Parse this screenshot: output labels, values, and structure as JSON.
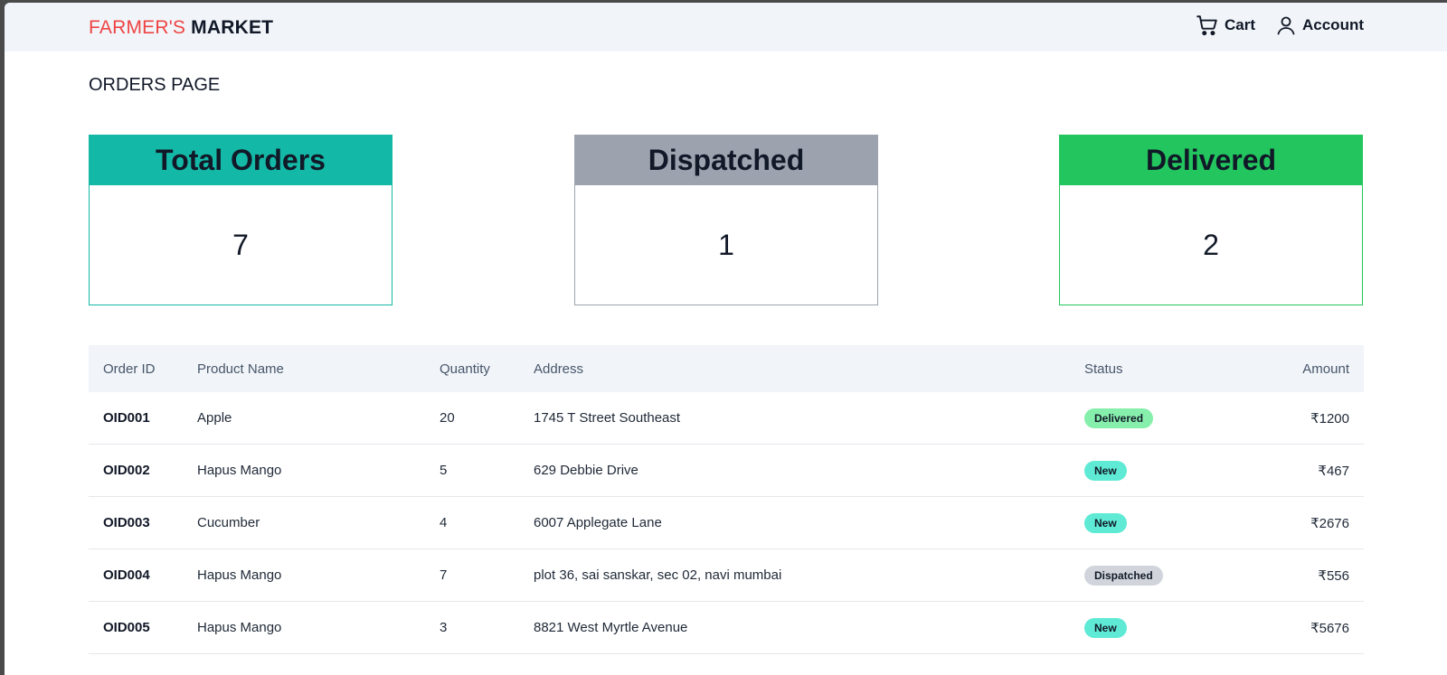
{
  "brand": {
    "part1": "FARMER'S",
    "part2": "MARKET"
  },
  "nav": {
    "cart_label": "Cart",
    "cart_icon": "cart-icon",
    "account_label": "Account",
    "account_icon": "user-icon"
  },
  "page_title": "ORDERS PAGE",
  "stats": [
    {
      "label": "Total Orders",
      "value": "7",
      "color": "#14b8a6"
    },
    {
      "label": "Dispatched",
      "value": "1",
      "color": "#9ca3af"
    },
    {
      "label": "Delivered",
      "value": "2",
      "color": "#22c55e"
    }
  ],
  "table": {
    "columns": [
      "Order ID",
      "Product Name",
      "Quantity",
      "Address",
      "Status",
      "Amount"
    ],
    "rows": [
      {
        "id": "OID001",
        "product": "Apple",
        "qty": "20",
        "address": "1745 T Street Southeast",
        "status": "Delivered",
        "status_class": "delivered",
        "amount": "₹1200"
      },
      {
        "id": "OID002",
        "product": "Hapus Mango",
        "qty": "5",
        "address": "629 Debbie Drive",
        "status": "New",
        "status_class": "new",
        "amount": "₹467"
      },
      {
        "id": "OID003",
        "product": "Cucumber",
        "qty": "4",
        "address": "6007 Applegate Lane",
        "status": "New",
        "status_class": "new",
        "amount": "₹2676"
      },
      {
        "id": "OID004",
        "product": "Hapus Mango",
        "qty": "7",
        "address": "plot 36, sai sanskar, sec 02, navi mumbai",
        "status": "Dispatched",
        "status_class": "dispatched",
        "amount": "₹556"
      },
      {
        "id": "OID005",
        "product": "Hapus Mango",
        "qty": "3",
        "address": "8821 West Myrtle Avenue",
        "status": "New",
        "status_class": "new",
        "amount": "₹5676"
      }
    ]
  },
  "colors": {
    "brand_red": "#ef4444",
    "navbar_bg": "#f1f5f9",
    "badge_delivered": "#86efac",
    "badge_new": "#5eead4",
    "badge_dispatched": "#d1d5db"
  }
}
